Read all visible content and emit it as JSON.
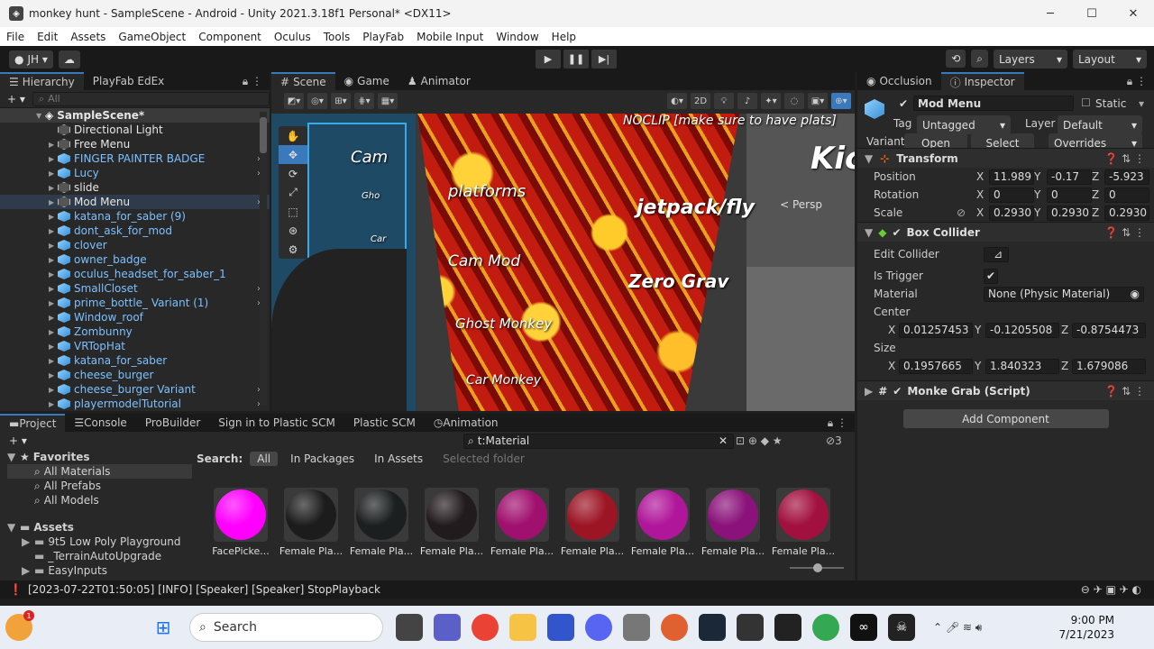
{
  "window": {
    "title": "monkey hunt - SampleScene - Android - Unity 2021.3.18f1 Personal* <DX11>",
    "minimize": "─",
    "maximize": "☐",
    "close": "✕"
  },
  "menu": [
    "File",
    "Edit",
    "Assets",
    "GameObject",
    "Component",
    "Oculus",
    "Tools",
    "PlayFab",
    "Mobile Input",
    "Window",
    "Help"
  ],
  "toolbar": {
    "account": "JH ▾",
    "layers": "Layers",
    "layout": "Layout"
  },
  "hierarchy": {
    "tabs": [
      "Hierarchy",
      "PlayFab EdEx"
    ],
    "search_placeholder": "All",
    "scene": "SampleScene*",
    "items": [
      {
        "label": "Directional Light",
        "color": "white",
        "icon": "grey",
        "arrow": false,
        "chev": false
      },
      {
        "label": "Free Menu",
        "color": "white",
        "icon": "grey",
        "arrow": true,
        "chev": false
      },
      {
        "label": "FINGER PAINTER BADGE",
        "color": "blue",
        "icon": "blue",
        "arrow": true,
        "chev": true
      },
      {
        "label": "Lucy",
        "color": "blue",
        "icon": "blue",
        "arrow": true,
        "chev": true
      },
      {
        "label": "slide",
        "color": "white",
        "icon": "grey",
        "arrow": true,
        "chev": false
      },
      {
        "label": "Mod Menu",
        "color": "white",
        "icon": "grey",
        "arrow": true,
        "chev": true
      },
      {
        "label": "katana_for_saber (9)",
        "color": "blue",
        "icon": "blue",
        "arrow": true,
        "chev": false
      },
      {
        "label": "dont_ask_for_mod",
        "color": "blue",
        "icon": "blue",
        "arrow": true,
        "chev": false
      },
      {
        "label": "clover",
        "color": "blue",
        "icon": "blue",
        "arrow": true,
        "chev": false
      },
      {
        "label": "owner_badge",
        "color": "blue",
        "icon": "blue",
        "arrow": true,
        "chev": false
      },
      {
        "label": "oculus_headset_for_saber_1",
        "color": "blue",
        "icon": "blue",
        "arrow": true,
        "chev": false
      },
      {
        "label": "SmallCloset",
        "color": "blue",
        "icon": "blue",
        "arrow": true,
        "chev": true
      },
      {
        "label": "prime_bottle_ Variant (1)",
        "color": "blue",
        "icon": "blue",
        "arrow": true,
        "chev": true
      },
      {
        "label": "Window_roof",
        "color": "blue",
        "icon": "blue",
        "arrow": true,
        "chev": false
      },
      {
        "label": "Zombunny",
        "color": "blue",
        "icon": "blue",
        "arrow": true,
        "chev": false
      },
      {
        "label": "VRTopHat",
        "color": "blue",
        "icon": "blue",
        "arrow": true,
        "chev": false
      },
      {
        "label": "katana_for_saber",
        "color": "blue",
        "icon": "blue",
        "arrow": true,
        "chev": false
      },
      {
        "label": "cheese_burger",
        "color": "blue",
        "icon": "blue",
        "arrow": true,
        "chev": false
      },
      {
        "label": "cheese_burger Variant",
        "color": "blue",
        "icon": "blue",
        "arrow": true,
        "chev": true
      },
      {
        "label": "playermodelTutorial",
        "color": "blue",
        "icon": "blue",
        "arrow": true,
        "chev": true
      }
    ]
  },
  "scene": {
    "tabs": [
      "Scene",
      "Game",
      "Animator"
    ],
    "mode_2d": "2D",
    "persp": "< Persp",
    "labels": {
      "noclip": "NOCLIP [make sure to have plats]",
      "cam": "Cam",
      "platforms": "platforms",
      "jetpack": "jetpack/fly",
      "cam_mod": "Cam Mod",
      "zero_grav": "Zero Grav",
      "ghost": "Ghost Monkey",
      "car": "Car Monkey",
      "kick": "Kic",
      "ghost_small": "Gho",
      "car_small": "Car"
    }
  },
  "inspector": {
    "tabs": [
      "Occlusion",
      "Inspector"
    ],
    "object_name": "Mod Menu",
    "static": "Static",
    "tag_label": "Tag",
    "tag_value": "Untagged",
    "layer_label": "Layer",
    "layer_value": "Default",
    "variant_label": "Variant",
    "open": "Open",
    "select": "Select",
    "overrides": "Overrides",
    "transform": {
      "title": "Transform",
      "position": {
        "label": "Position",
        "x": "11.989",
        "y": "-0.17",
        "z": "-5.923"
      },
      "rotation": {
        "label": "Rotation",
        "x": "0",
        "y": "0",
        "z": "0"
      },
      "scale": {
        "label": "Scale",
        "x": "0.2930",
        "y": "0.2930",
        "z": "0.2930"
      }
    },
    "box_collider": {
      "title": "Box Collider",
      "edit_collider": "Edit Collider",
      "is_trigger": "Is Trigger",
      "material_label": "Material",
      "material_value": "None (Physic Material)",
      "center_label": "Center",
      "center": {
        "x": "0.01257453",
        "y": "-0.1205508",
        "z": "-0.8754473"
      },
      "size_label": "Size",
      "size": {
        "x": "0.1957665",
        "y": "1.840323",
        "z": "1.679086"
      }
    },
    "script": {
      "title": "Monke Grab (Script)"
    },
    "add_component": "Add Component"
  },
  "project": {
    "tabs": [
      "Project",
      "Console",
      "ProBuilder",
      "Sign in to Plastic SCM",
      "Plastic SCM",
      "Animation"
    ],
    "search_value": "t:Material",
    "search_label": "Search:",
    "filters": [
      "All",
      "In Packages",
      "In Assets",
      "Selected folder"
    ],
    "hidden_count": "3",
    "favorites_title": "Favorites",
    "favorites": [
      "All Materials",
      "All Prefabs",
      "All Models"
    ],
    "assets_title": "Assets",
    "assets": [
      "9t5 Low Poly Playground",
      "_TerrainAutoUpgrade",
      "EasyInputs"
    ],
    "materials": [
      {
        "name": "FacePicke...",
        "color": "#ff00ff"
      },
      {
        "name": "Female Pla...",
        "color": "#1c1c1c"
      },
      {
        "name": "Female Pla...",
        "color": "#1c1f20"
      },
      {
        "name": "Female Pla...",
        "color": "#221b1e"
      },
      {
        "name": "Female Pla...",
        "color": "#a0106e"
      },
      {
        "name": "Female Pla...",
        "color": "#9c1525"
      },
      {
        "name": "Female Pla...",
        "color": "#b0169a"
      },
      {
        "name": "Female Pla...",
        "color": "#8a127a"
      },
      {
        "name": "Female Pla...",
        "color": "#a21040"
      }
    ]
  },
  "status": {
    "message": "[2023-07-22T01:50:05] [INFO] [Speaker] [Speaker] StopPlayback"
  },
  "taskbar": {
    "search": "Search",
    "time": "9:00 PM",
    "date": "7/21/2023",
    "badge": "1"
  }
}
